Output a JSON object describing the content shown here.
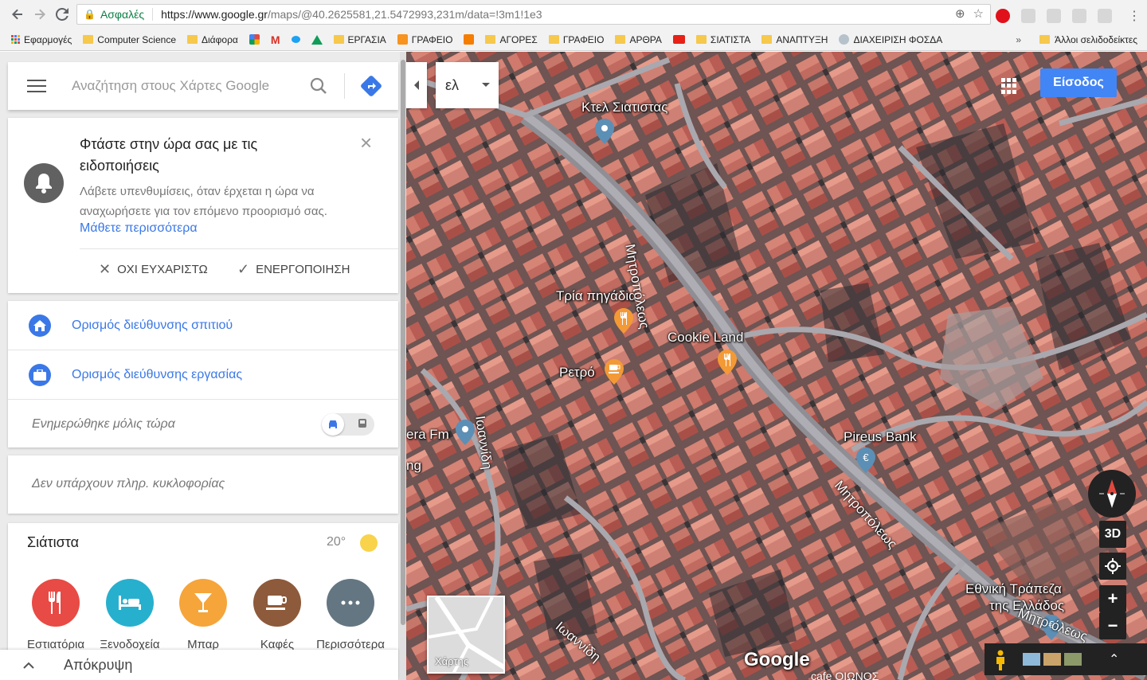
{
  "browser": {
    "secure_label": "Ασφαλές",
    "url_host": "https://www.google.gr",
    "url_rest": "/maps/@40.2625581,21.5472993,231m/data=!3m1!1e3",
    "bookmarks": [
      "Εφαρμογές",
      "Computer Science",
      "Διάφορα",
      "ΕΡΓΑΣΙΑ",
      "ΓΡΑΦΕΙΟ",
      "ΑΓΟΡΕΣ",
      "ΓΡΑΦΕΙΟ",
      "ΑΡΘΡΑ",
      "ΣΙΑΤΙΣΤΑ",
      "ΑΝΑΠΤΥΞΗ",
      "ΔΙΑΧΕΙΡΙΣΗ ΦΟΣΔΑ"
    ],
    "bookmarks_more": "»",
    "other_bookmarks": "Άλλοι σελιδοδείκτες"
  },
  "search": {
    "placeholder": "Αναζήτηση στους Χάρτες Google"
  },
  "notification": {
    "title": "Φτάστε στην ώρα σας με τις ειδοποιήσεις",
    "body": "Λάβετε υπενθυμίσεις, όταν έρχεται η ώρα να αναχωρήσετε για τον επόμενο προορισμό σας.",
    "link": "Μάθετε περισσότερα",
    "decline": "ΟΧΙ ΕΥΧΑΡΙΣΤΩ",
    "accept": "ΕΝΕΡΓΟΠΟΙΗΣΗ"
  },
  "addresses": {
    "home": "Ορισμός διεύθυνσης σπιτιού",
    "work": "Ορισμός διεύθυνσης εργασίας",
    "updated": "Ενημερώθηκε μόλις τώρα"
  },
  "traffic": {
    "text": "Δεν υπάρχουν πληρ. κυκλοφορίας"
  },
  "explore": {
    "town": "Σιάτιστα",
    "temperature": "20°",
    "categories": [
      {
        "label": "Εστιατόρια",
        "color": "#e84a45"
      },
      {
        "label": "Ξενοδοχεία",
        "color": "#27b0ce"
      },
      {
        "label": "Μπαρ",
        "color": "#f5a53a"
      },
      {
        "label": "Καφές",
        "color": "#8d5a3b"
      },
      {
        "label": "Περισσότερα",
        "color": "#647682"
      }
    ]
  },
  "hide_label": "Απόκρυψη",
  "map": {
    "language": "ελ",
    "signin": "Είσοδος",
    "places": {
      "ktel": "Κτελ Σιατιστας",
      "tria": "Τρία πηγάδια",
      "cookie": "Cookie Land",
      "retro": "Ρετρό",
      "pireus": "Pireus Bank",
      "ethniki1": "Εθνική Τράπεζα",
      "ethniki2": "της Ελλάδος",
      "eraFm": "era Fm",
      "ng": "ng"
    },
    "streets": {
      "mitropoleos": "Μητροπόλεως",
      "ioannidi": "Ιωαννίδη",
      "mitro_cut": "Μητρ όλεως"
    },
    "cut_bottom": "cafe ΟΙΩΝΟΣ",
    "threeD": "3D",
    "zoom_in": "+",
    "zoom_out": "−",
    "minimap_label": "Χάρτης",
    "logo": "Google"
  }
}
